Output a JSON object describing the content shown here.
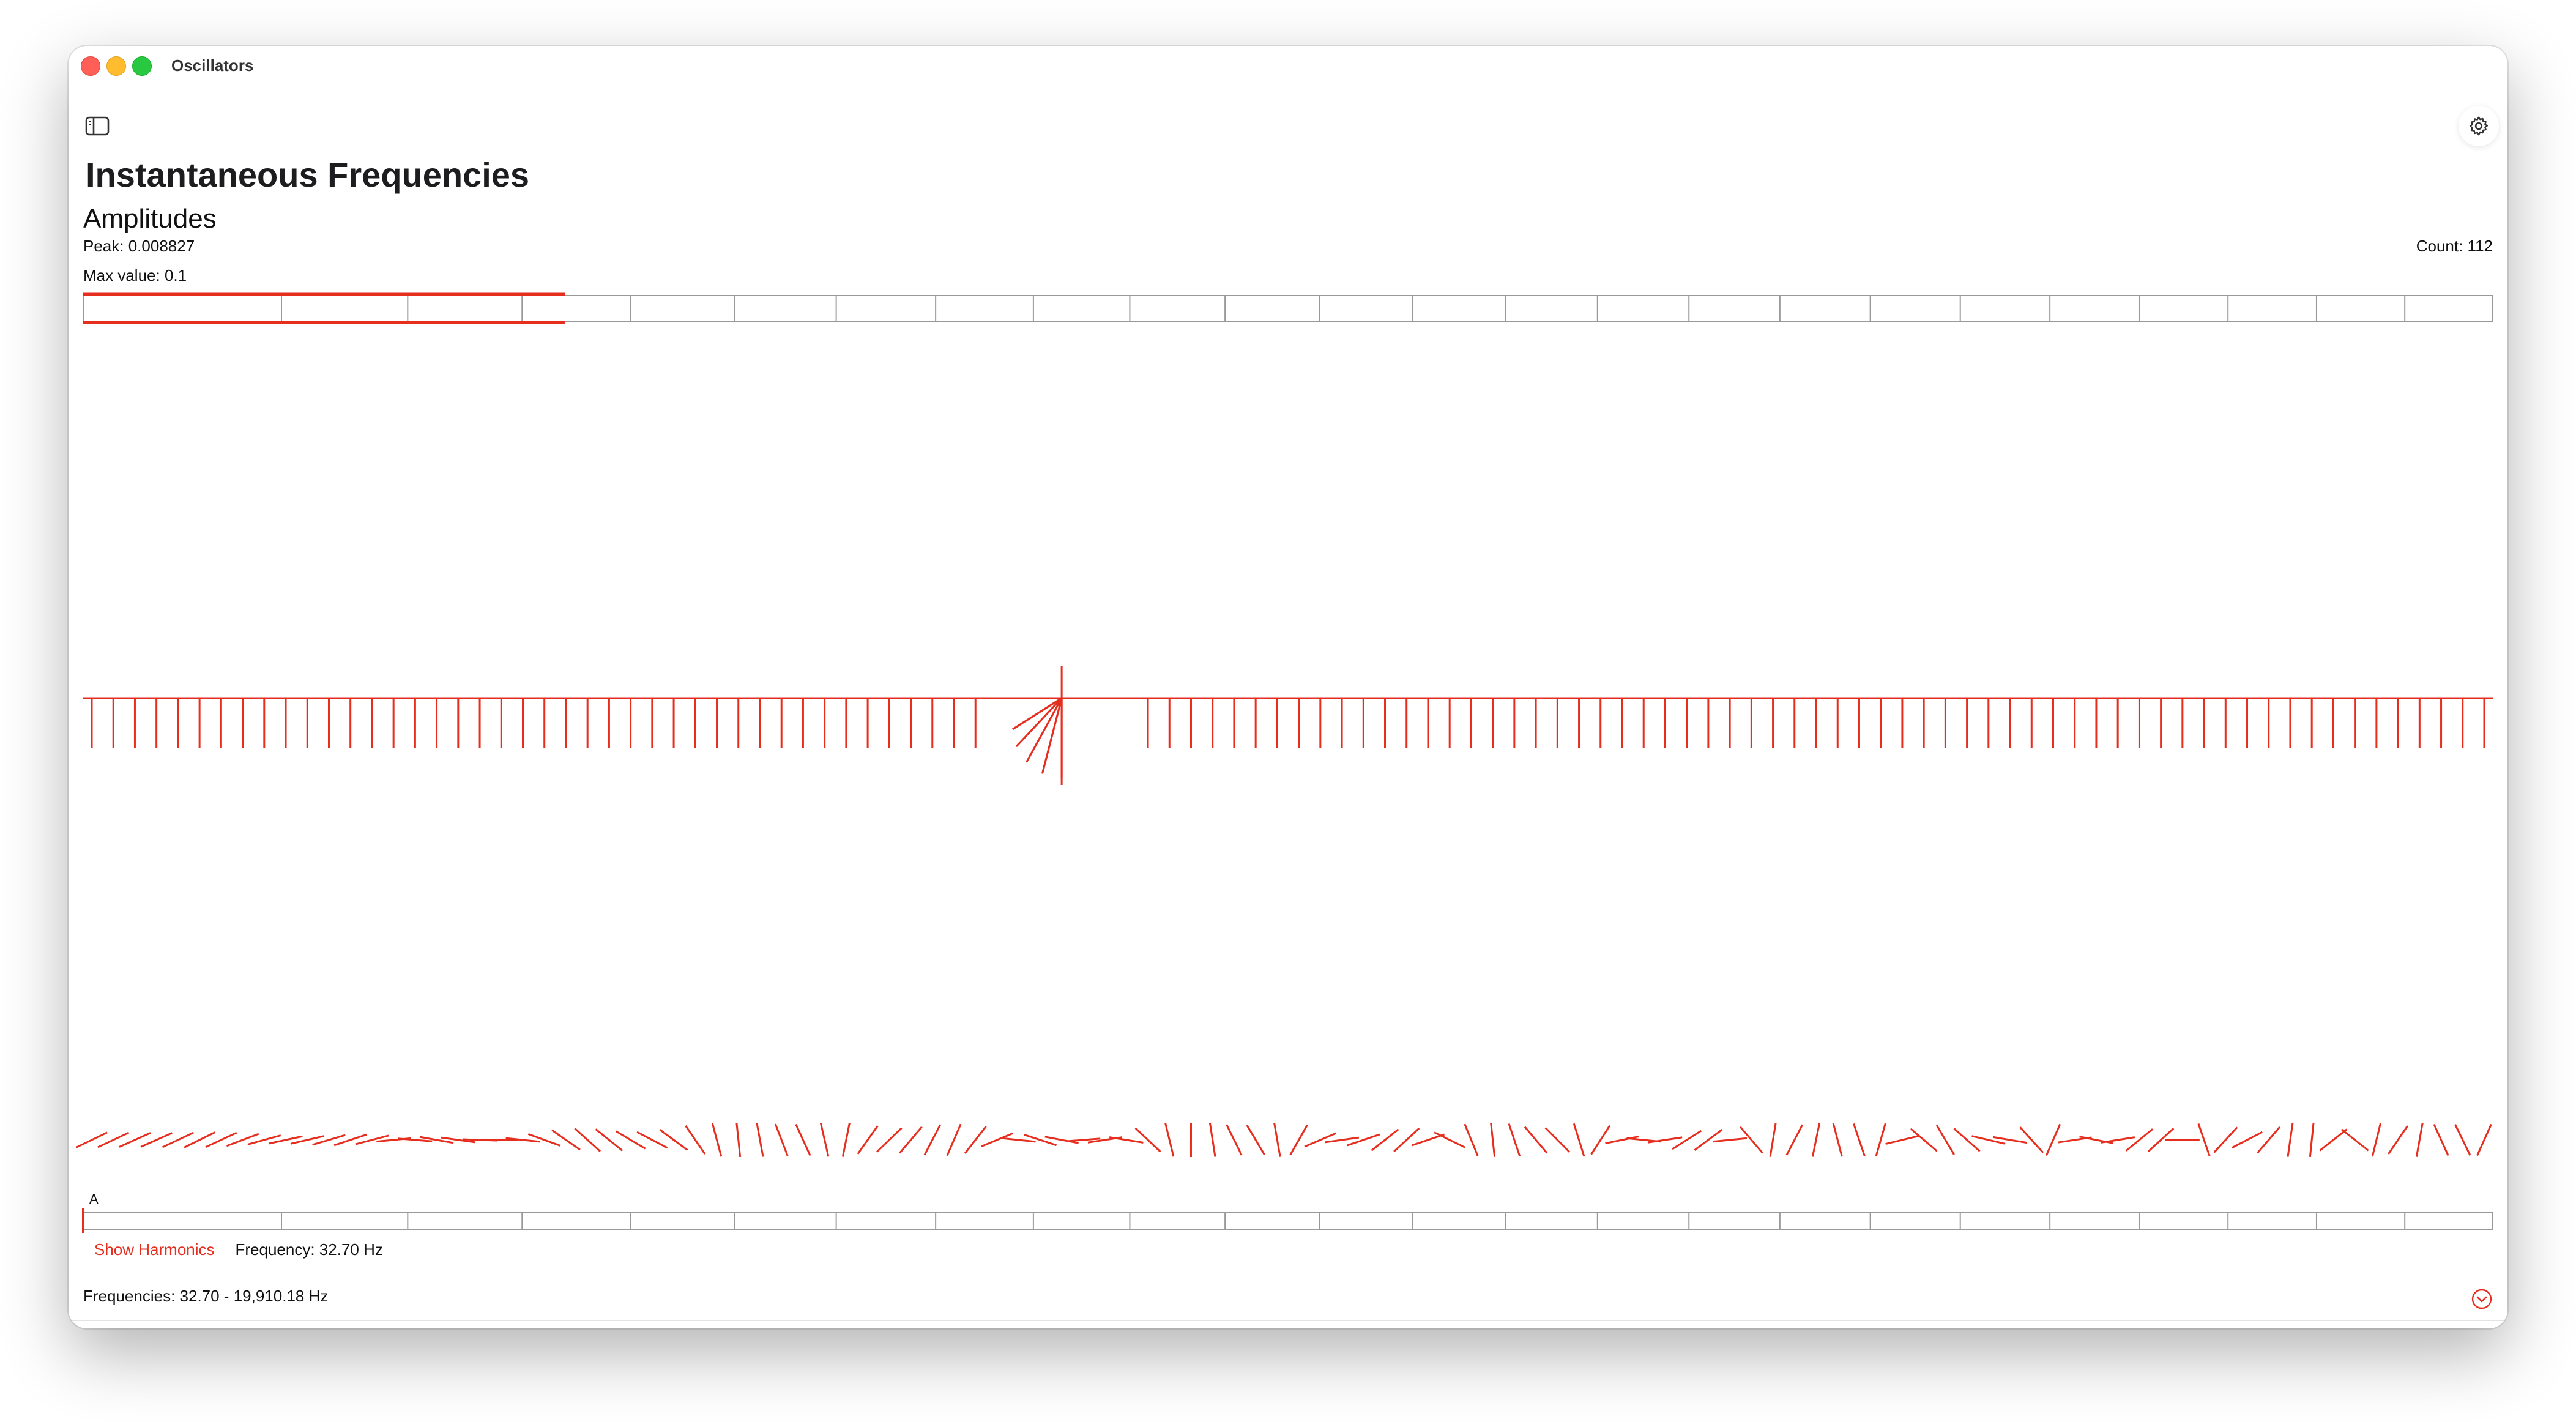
{
  "window": {
    "title": "Oscillators"
  },
  "toolbar": {
    "sidebar_icon": "sidebar-icon",
    "settings_icon": "gear-icon"
  },
  "page": {
    "title": "Instantaneous Frequencies",
    "section_title": "Amplitudes",
    "peak": "Peak: 0.008827",
    "max_value": "Max value: 0.1",
    "count": "Count: 112",
    "pointer_label": "A"
  },
  "controls": {
    "show_harmonics": "Show Harmonics",
    "frequency": "Frequency: 32.70 Hz",
    "frequencies_range": "Frequencies: 32.70 - 19,910.18 Hz",
    "collapse_icon": "chevron-down-circle-icon"
  },
  "colors": {
    "accent": "#e62e1f",
    "grid": "#999999",
    "text": "#1d1d1f"
  },
  "chart_data": {
    "type": "line",
    "amplitude_bar": {
      "highlighted_fraction": 0.2
    },
    "stems": {
      "count": 112,
      "fan_center_index": 45,
      "fan_spokes": 9
    },
    "selection_index": 0
  }
}
